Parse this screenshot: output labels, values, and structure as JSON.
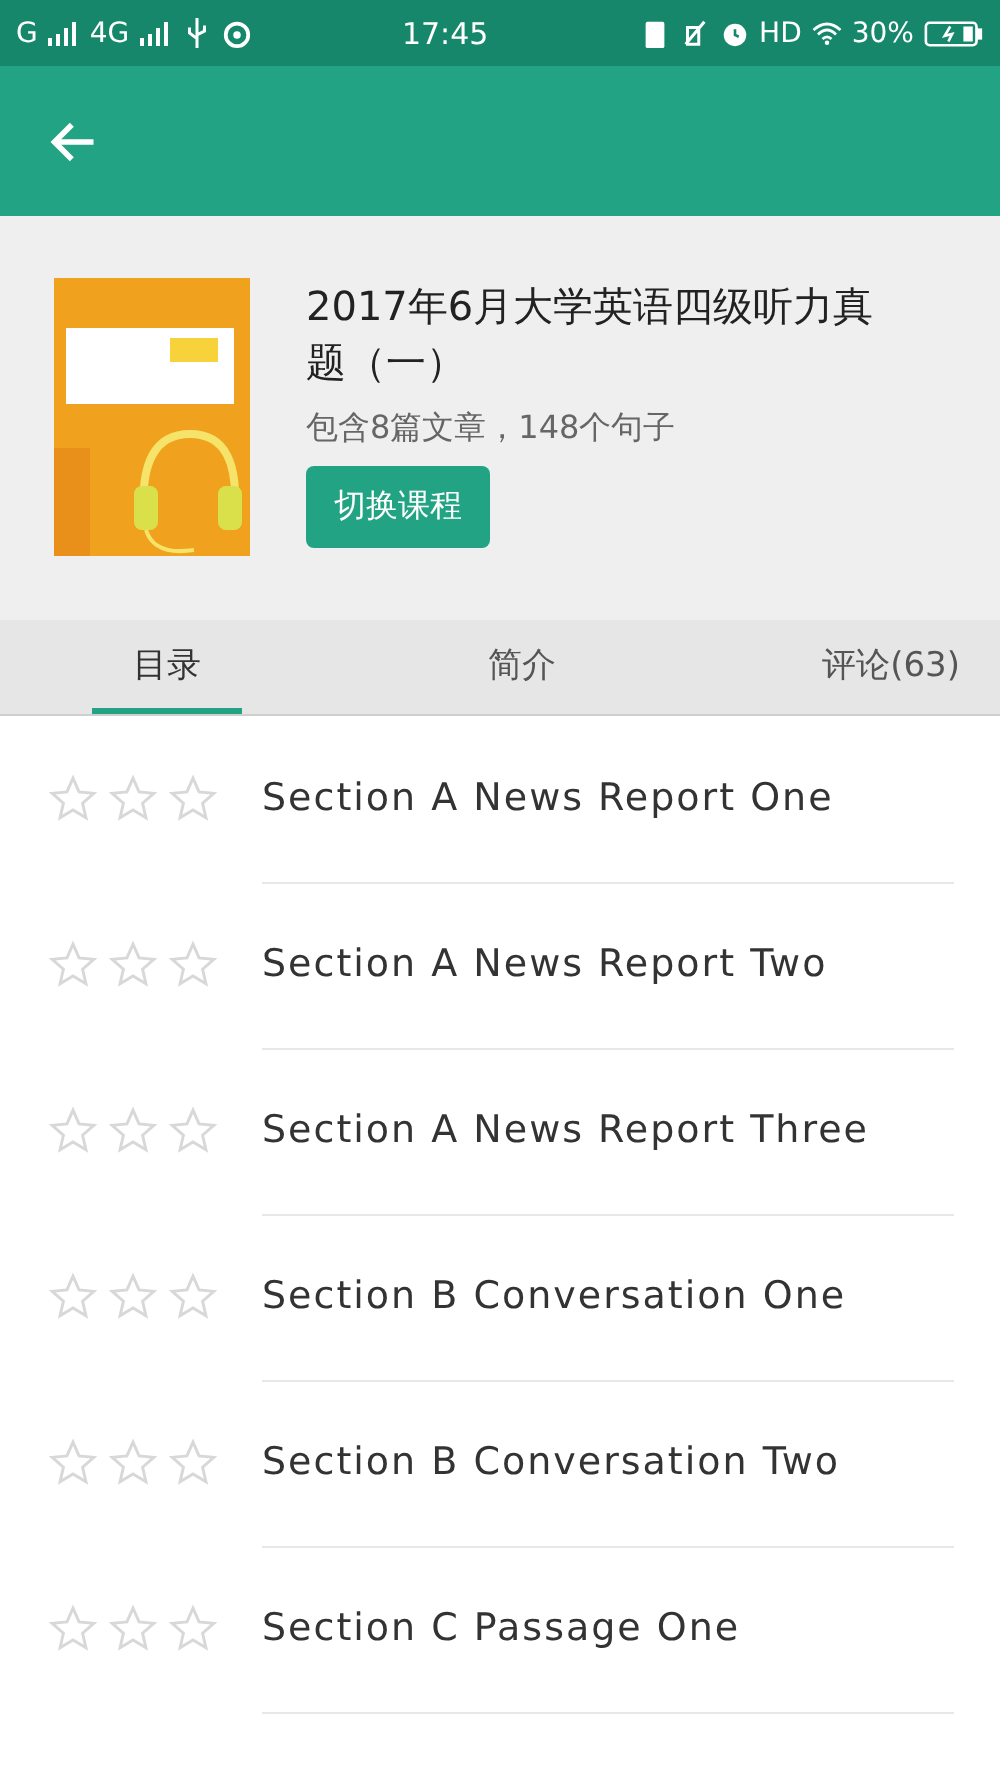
{
  "status_bar": {
    "network_1": "G",
    "network_2": "4G",
    "time": "17:45",
    "hd": "HD",
    "battery": "30%"
  },
  "course": {
    "title": "2017年6月大学英语四级听力真题（一）",
    "subtitle": "包含8篇文章，148个句子",
    "button": "切换课程"
  },
  "tabs": [
    {
      "label": "目录",
      "selected": true
    },
    {
      "label": "简介",
      "selected": false
    },
    {
      "label": "评论(63)",
      "selected": false
    }
  ],
  "lessons": [
    {
      "title": "Section A News Report One",
      "stars": 0
    },
    {
      "title": "Section A News Report Two",
      "stars": 0
    },
    {
      "title": "Section A News Report Three",
      "stars": 0
    },
    {
      "title": "Section B Conversation One",
      "stars": 0
    },
    {
      "title": "Section B Conversation Two",
      "stars": 0
    },
    {
      "title": "Section C Passage One",
      "stars": 0
    }
  ]
}
